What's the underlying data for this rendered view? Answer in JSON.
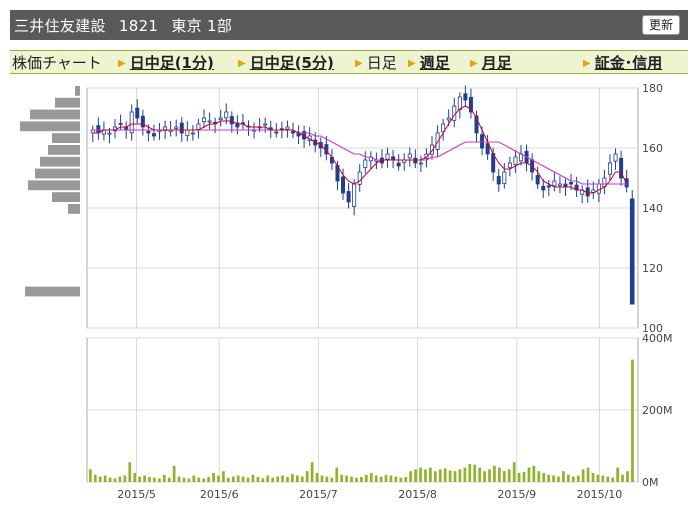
{
  "header": {
    "company_name": "三井住友建設",
    "code": "1821",
    "market": "東京 1部",
    "refresh_label": "更新"
  },
  "tabs": [
    {
      "label": "株価チャート",
      "kind": "first"
    },
    {
      "label": "日中足(1分)",
      "kind": "link"
    },
    {
      "label": "日中足(5分)",
      "kind": "link"
    },
    {
      "label": "日足",
      "kind": "plain"
    },
    {
      "label": "週足",
      "kind": "link"
    },
    {
      "label": "月足",
      "kind": "link"
    },
    {
      "label": "証金･信用",
      "kind": "link"
    }
  ],
  "colors": {
    "header_bg": "#5a5a5a",
    "tab_bg": "#eef3d2",
    "candle_up": "#ffffff",
    "candle_down": "#1f3f8f",
    "ma_short": "#cc0033",
    "ma_long": "#cc33cc",
    "volume": "#8db42a",
    "volume_profile": "#999999",
    "grid": "#d8d8d8",
    "arrow_icon": "#e0a800"
  },
  "chart_data": [
    {
      "type": "candlestick",
      "title": "",
      "ylim": [
        100,
        180
      ],
      "y_ticks": [
        "180",
        "160",
        "140",
        "120",
        "100"
      ],
      "x_ticks": [
        "2015/5",
        "2015/6",
        "2015/7",
        "2015/8",
        "2015/9",
        "2015/10"
      ],
      "close_series_approx": [
        166,
        165,
        166,
        165,
        167,
        168,
        166,
        172,
        170,
        167,
        165,
        164,
        166,
        167,
        166,
        167,
        165,
        166,
        165,
        168,
        170,
        169,
        168,
        170,
        172,
        168,
        167,
        168,
        167,
        166,
        167,
        168,
        166,
        165,
        166,
        167,
        165,
        164,
        163,
        164,
        161,
        160,
        158,
        155,
        149,
        145,
        142,
        148,
        152,
        156,
        157,
        156,
        155,
        158,
        156,
        154,
        156,
        158,
        155,
        155,
        158,
        161,
        165,
        168,
        170,
        174,
        177,
        176,
        172,
        165,
        160,
        158,
        152,
        148,
        152,
        155,
        157,
        158,
        155,
        152,
        148,
        146,
        147,
        149,
        148,
        147,
        148,
        146,
        146,
        144,
        146,
        148,
        150,
        155,
        158,
        150,
        147
      ],
      "price_labels_note": "last candle drops to ~108",
      "ma_short_approx": [
        165,
        165,
        166,
        166,
        166,
        167,
        167,
        168,
        168,
        168,
        167,
        166,
        166,
        166,
        166,
        166,
        166,
        166,
        166,
        166,
        167,
        168,
        168,
        169,
        169,
        169,
        168,
        168,
        167,
        167,
        167,
        167,
        166,
        166,
        166,
        166,
        166,
        165,
        164,
        163,
        162,
        161,
        159,
        157,
        154,
        151,
        149,
        148,
        149,
        151,
        153,
        155,
        156,
        156,
        156,
        156,
        156,
        156,
        156,
        156,
        157,
        159,
        162,
        165,
        168,
        171,
        173,
        174,
        173,
        170,
        166,
        162,
        158,
        155,
        153,
        153,
        154,
        155,
        155,
        154,
        152,
        149,
        148,
        147,
        147,
        147,
        147,
        146,
        146,
        145,
        145,
        146,
        147,
        149,
        152,
        152,
        148
      ],
      "ma_long_approx": [
        166,
        166,
        166,
        166,
        166,
        166,
        166,
        166,
        166,
        166,
        166,
        166,
        166,
        166,
        166,
        166,
        166,
        166,
        166,
        166,
        166,
        166,
        166,
        166,
        166,
        166,
        166,
        166,
        166,
        166,
        166,
        166,
        166,
        166,
        166,
        166,
        166,
        165,
        165,
        165,
        164,
        164,
        163,
        162,
        161,
        160,
        159,
        158,
        158,
        157,
        157,
        156,
        156,
        156,
        156,
        156,
        156,
        156,
        156,
        156,
        156,
        157,
        157,
        158,
        159,
        160,
        161,
        162,
        162,
        162,
        162,
        162,
        162,
        162,
        161,
        160,
        159,
        158,
        157,
        156,
        155,
        154,
        153,
        152,
        151,
        150,
        149,
        149,
        148,
        148,
        148,
        148,
        148,
        148,
        148,
        148,
        148
      ]
    },
    {
      "type": "bar",
      "title": "",
      "ylim": [
        0,
        400
      ],
      "y_ticks": [
        "400M",
        "200M",
        "0M"
      ],
      "unit": "M",
      "values": [
        35,
        20,
        15,
        18,
        12,
        10,
        15,
        18,
        55,
        25,
        15,
        18,
        14,
        12,
        10,
        20,
        12,
        45,
        15,
        12,
        10,
        18,
        12,
        10,
        14,
        25,
        18,
        30,
        12,
        15,
        18,
        15,
        12,
        20,
        14,
        10,
        18,
        12,
        15,
        18,
        14,
        22,
        18,
        15,
        30,
        55,
        25,
        18,
        15,
        12,
        40,
        20,
        18,
        15,
        12,
        14,
        20,
        25,
        18,
        15,
        20,
        18,
        15,
        12,
        14,
        30,
        35,
        40,
        35,
        40,
        30,
        35,
        38,
        32,
        30,
        35,
        40,
        50,
        48,
        40,
        30,
        35,
        45,
        40,
        30,
        35,
        55,
        25,
        28,
        40,
        45,
        30,
        25,
        20,
        18,
        15,
        30,
        20,
        15,
        18,
        35,
        40,
        25,
        20,
        18,
        15,
        12,
        40,
        20,
        30,
        340
      ]
    },
    {
      "type": "bar",
      "title": "",
      "orientation": "horizontal",
      "note": "volume-by-price profile",
      "values": [
        5,
        25,
        50,
        60,
        28,
        32,
        40,
        45,
        52,
        28,
        12,
        0,
        0,
        0,
        0,
        0,
        0,
        55
      ]
    }
  ]
}
